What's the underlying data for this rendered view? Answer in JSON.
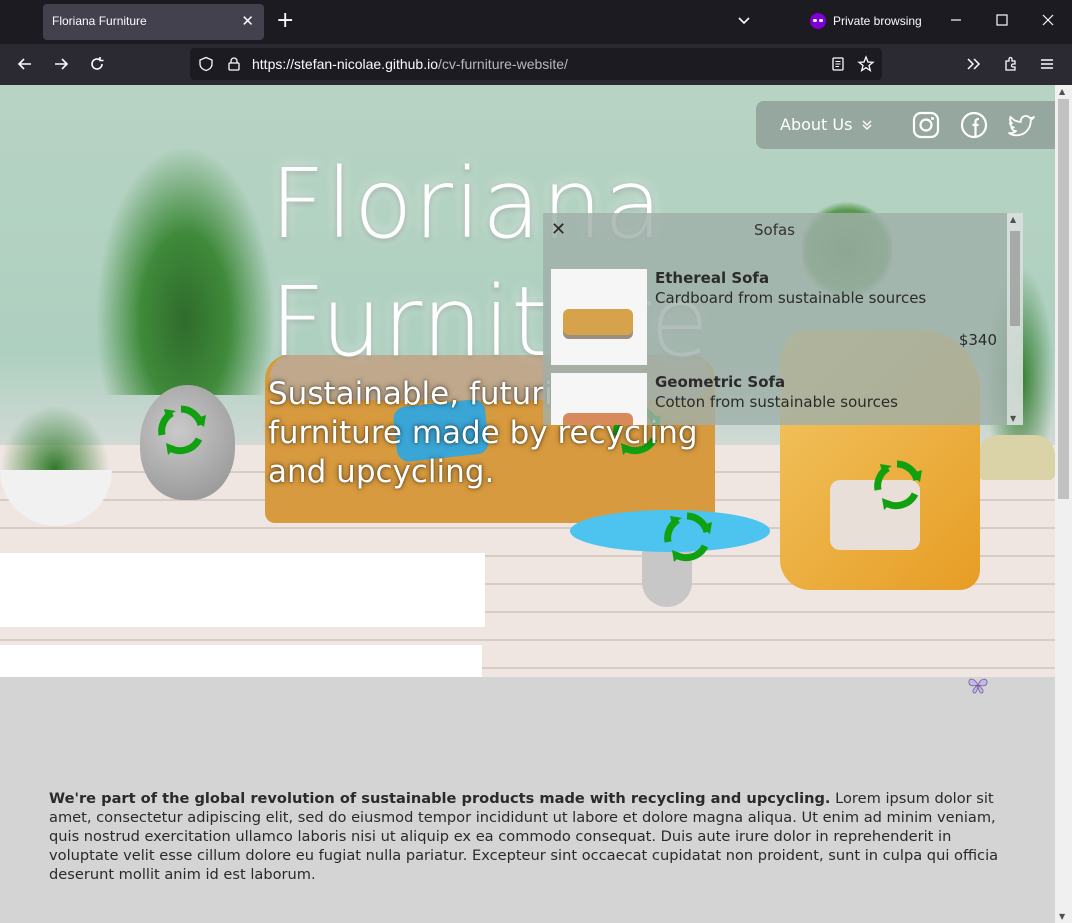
{
  "browser": {
    "tab_title": "Floriana Furniture",
    "private_label": "Private browsing",
    "url_host": "https://stefan-nicolae.github.io",
    "url_path": "/cv-furniture-website/"
  },
  "site": {
    "nav": {
      "about_label": "About Us",
      "social": [
        "instagram-icon",
        "facebook-icon",
        "twitter-icon"
      ]
    },
    "hero": {
      "title_line1": "Floriana",
      "title_line2": "Furniture",
      "subtitle": "Sustainable, futuristic furniture made by recycling and upcycling."
    },
    "popup": {
      "title": "Sofas",
      "items": [
        {
          "name": "Ethereal Sofa",
          "description": "Cardboard from sustainable sources",
          "price": "$340"
        },
        {
          "name": "Geometric Sofa",
          "description": "Cotton from sustainable sources"
        }
      ]
    },
    "about": {
      "lead": "We're part of the global revolution of sustainable products made with recycling and upcycling.",
      "body": " Lorem ipsum dolor sit amet, consectetur adipiscing elit, sed do eiusmod tempor incididunt ut labore et dolore magna aliqua. Ut enim ad minim veniam, quis nostrud exercitation ullamco laboris nisi ut aliquip ex ea commodo consequat. Duis aute irure dolor in reprehenderit in voluptate velit esse cillum dolore eu fugiat nulla pariatur. Excepteur sint occaecat cupidatat non proident, sunt in culpa qui officia deserunt mollit anim id est laborum."
    },
    "colors": {
      "recycle_green": "#10a010",
      "popup_bg": "#a0b0aa"
    }
  }
}
